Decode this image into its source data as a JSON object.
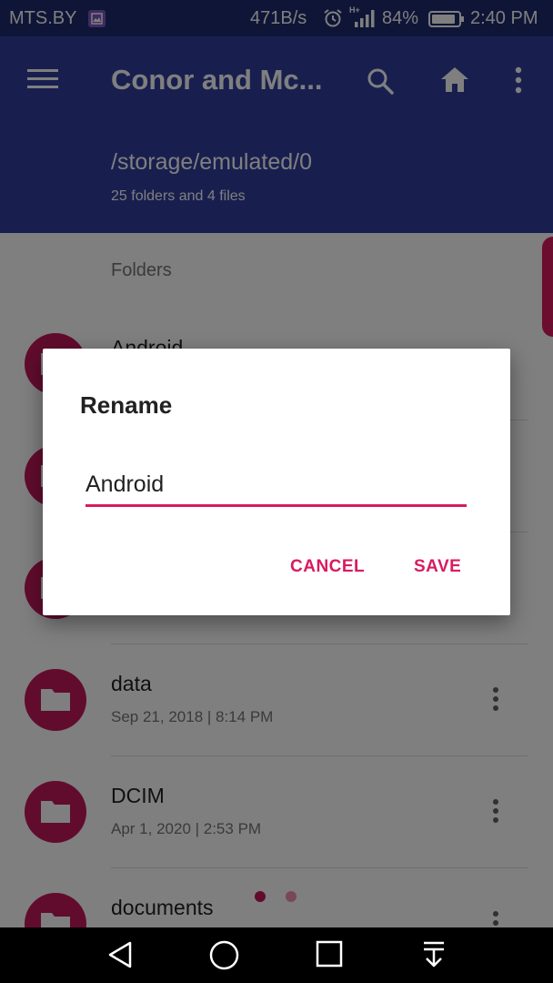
{
  "status_bar": {
    "carrier": "MTS.BY",
    "net_speed": "471B/s",
    "network_type": "H+",
    "battery_percent": "84%",
    "time": "2:40 PM",
    "icons": [
      "gallery-icon",
      "alarm-icon",
      "signal-icon",
      "battery-icon"
    ]
  },
  "app_bar": {
    "title": "Conor and Mc...",
    "path": "/storage/emulated/0",
    "summary": "25 folders and 4 files",
    "icons": [
      "menu-icon",
      "search-icon",
      "home-icon",
      "more-vert-icon"
    ],
    "color": "#303f9f"
  },
  "list": {
    "section_header": "Folders",
    "items": [
      {
        "name": "Android",
        "meta": ""
      },
      {
        "name": "",
        "meta": ""
      },
      {
        "name": "",
        "meta": ""
      },
      {
        "name": "data",
        "meta": "Sep 21, 2018 | 8:14 PM"
      },
      {
        "name": "DCIM",
        "meta": "Apr 1, 2020 | 2:53 PM"
      },
      {
        "name": "documents",
        "meta": ""
      }
    ],
    "folder_icon": "folder-icon",
    "accent_color": "#c2185b"
  },
  "dialog": {
    "title": "Rename",
    "input_value": "Android",
    "cancel_label": "CANCEL",
    "save_label": "SAVE",
    "accent_color": "#d81b60"
  },
  "pager": {
    "page_count": 2,
    "current_page": 1
  },
  "nav_bar": {
    "icons": [
      "back-icon",
      "home-circle-icon",
      "recents-icon",
      "notification-pull-icon"
    ]
  }
}
